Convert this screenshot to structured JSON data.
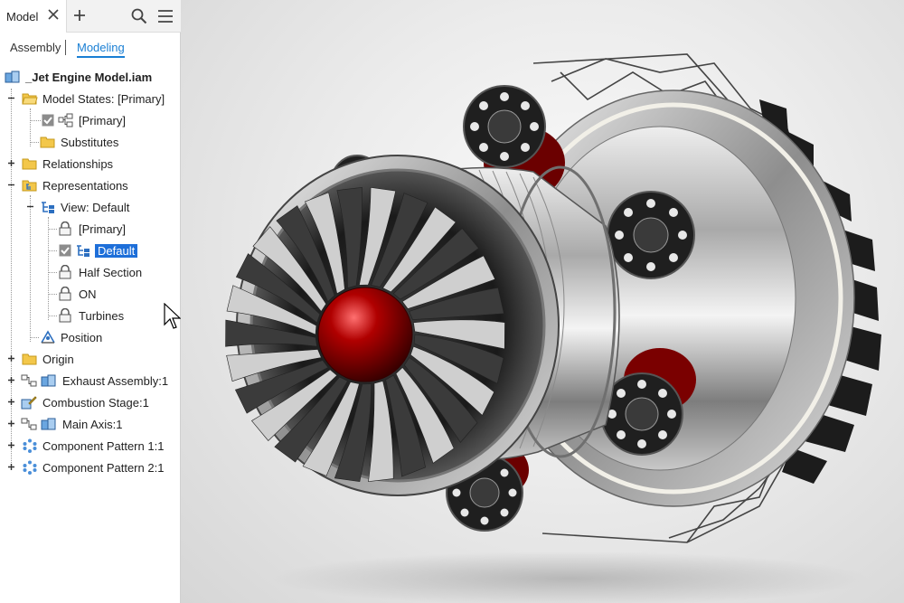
{
  "tabs": {
    "active_label": "Model"
  },
  "modes": {
    "assembly": "Assembly",
    "modeling": "Modeling"
  },
  "tree": {
    "root": "_Jet Engine Model.iam",
    "model_states": "Model States: [Primary]",
    "model_state_primary": "[Primary]",
    "substitutes": "Substitutes",
    "relationships": "Relationships",
    "representations": "Representations",
    "view_default": "View: Default",
    "view_items": [
      "[Primary]",
      "Default",
      "Half Section",
      "ON",
      "Turbines"
    ],
    "position": "Position",
    "origin": "Origin",
    "exhaust": "Exhaust Assembly:1",
    "combustion": "Combustion Stage:1",
    "main_axis": "Main Axis:1",
    "pattern1": "Component Pattern 1:1",
    "pattern2": "Component Pattern 2:1"
  },
  "colors": {
    "accent": "#1a7fd4",
    "selection": "#1e6fd9",
    "folder": "#f3c74a",
    "nose_cone": "#8b0000"
  },
  "icons": [
    "close-icon",
    "plus-icon",
    "search-icon",
    "hamburger-menu-icon",
    "assembly-icon",
    "folder-icon",
    "lock-icon",
    "checkbox-icon",
    "view-rep-icon",
    "position-icon",
    "component-icon",
    "pattern-icon",
    "cursor-icon"
  ]
}
